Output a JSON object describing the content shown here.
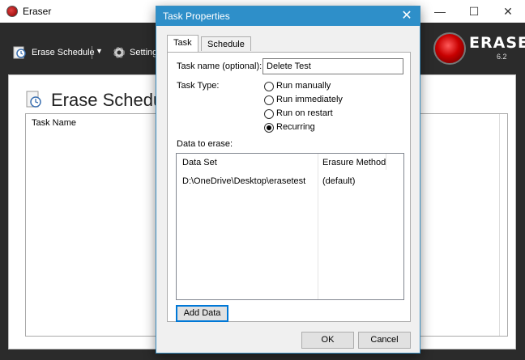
{
  "app": {
    "title": "Eraser",
    "minimize": "—",
    "maximize": "☐",
    "close": "✕"
  },
  "toolbar": {
    "erase_schedule_label": "Erase Schedule",
    "dropdown_arrow": "▼",
    "settings_label": "Settings",
    "brand_name": "ERASER",
    "brand_version": "6.2"
  },
  "main": {
    "page_title": "Erase Schedule",
    "task_list_header": "Task Name"
  },
  "dialog": {
    "title": "Task Properties",
    "close": "✕",
    "tabs": [
      {
        "label": "Task",
        "active": true
      },
      {
        "label": "Schedule",
        "active": false
      }
    ],
    "task_name_label": "Task name (optional):",
    "task_name_value": "Delete Test",
    "task_type_label": "Task Type:",
    "task_types": [
      {
        "label": "Run manually",
        "checked": false
      },
      {
        "label": "Run immediately",
        "checked": false
      },
      {
        "label": "Run on restart",
        "checked": false
      },
      {
        "label": "Recurring",
        "checked": true
      }
    ],
    "data_to_erase_label": "Data to erase:",
    "columns": {
      "data_set": "Data Set",
      "erasure_method": "Erasure Method"
    },
    "rows": [
      {
        "data_set": "D:\\OneDrive\\Desktop\\erasetest",
        "erasure_method": "(default)"
      }
    ],
    "add_data_label": "Add Data",
    "ok_label": "OK",
    "cancel_label": "Cancel"
  },
  "colors": {
    "dialog_titlebar": "#2e8fc9",
    "toolbar_bg": "#2b2b2b",
    "default_button_border": "#0078d7"
  }
}
